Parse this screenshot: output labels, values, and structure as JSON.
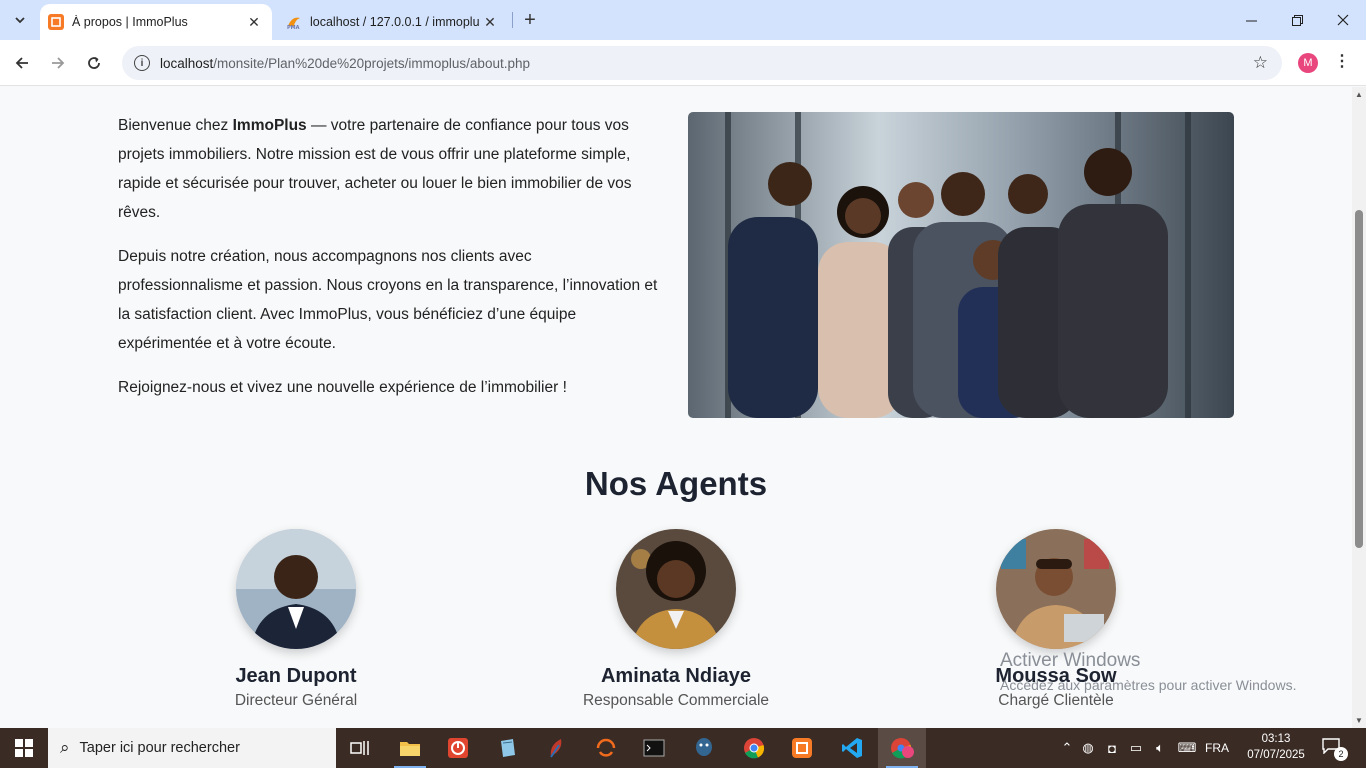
{
  "browser": {
    "tabs": [
      {
        "title": "À propos | ImmoPlus",
        "active": true
      },
      {
        "title": "localhost / 127.0.0.1 / immoplus",
        "active": false
      }
    ],
    "url_host": "localhost",
    "url_path": "/monsite/Plan%20de%20projets/immoplus/about.php",
    "profile_initial": "M"
  },
  "intro": {
    "p1_before": "Bienvenue chez ",
    "p1_brand": "ImmoPlus",
    "p1_after": " — votre partenaire de confiance pour tous vos projets immobiliers. Notre mission est de vous offrir une plateforme simple, rapide et sécurisée pour trouver, acheter ou louer le bien immobilier de vos rêves.",
    "p2": "Depuis notre création, nous accompagnons nos clients avec professionnalisme et passion. Nous croyons en la transparence, l’innovation et la satisfaction client. Avec ImmoPlus, vous bénéficiez d’une équipe expérimentée et à votre écoute.",
    "p3": "Rejoignez-nous et vivez une nouvelle expérience de l’immobilier !"
  },
  "agents_section": {
    "title": "Nos Agents",
    "agents": [
      {
        "name": "Jean Dupont",
        "role": "Directeur Général"
      },
      {
        "name": "Aminata Ndiaye",
        "role": "Responsable Commerciale"
      },
      {
        "name": "Moussa Sow",
        "role": "Chargé Clientèle"
      }
    ]
  },
  "watermark": {
    "title": "Activer Windows",
    "subtitle": "Accédez aux paramètres pour activer Windows."
  },
  "taskbar": {
    "search_placeholder": "Taper ici pour rechercher",
    "language": "FRA",
    "time": "03:13",
    "date": "07/07/2025",
    "notification_count": "2"
  }
}
